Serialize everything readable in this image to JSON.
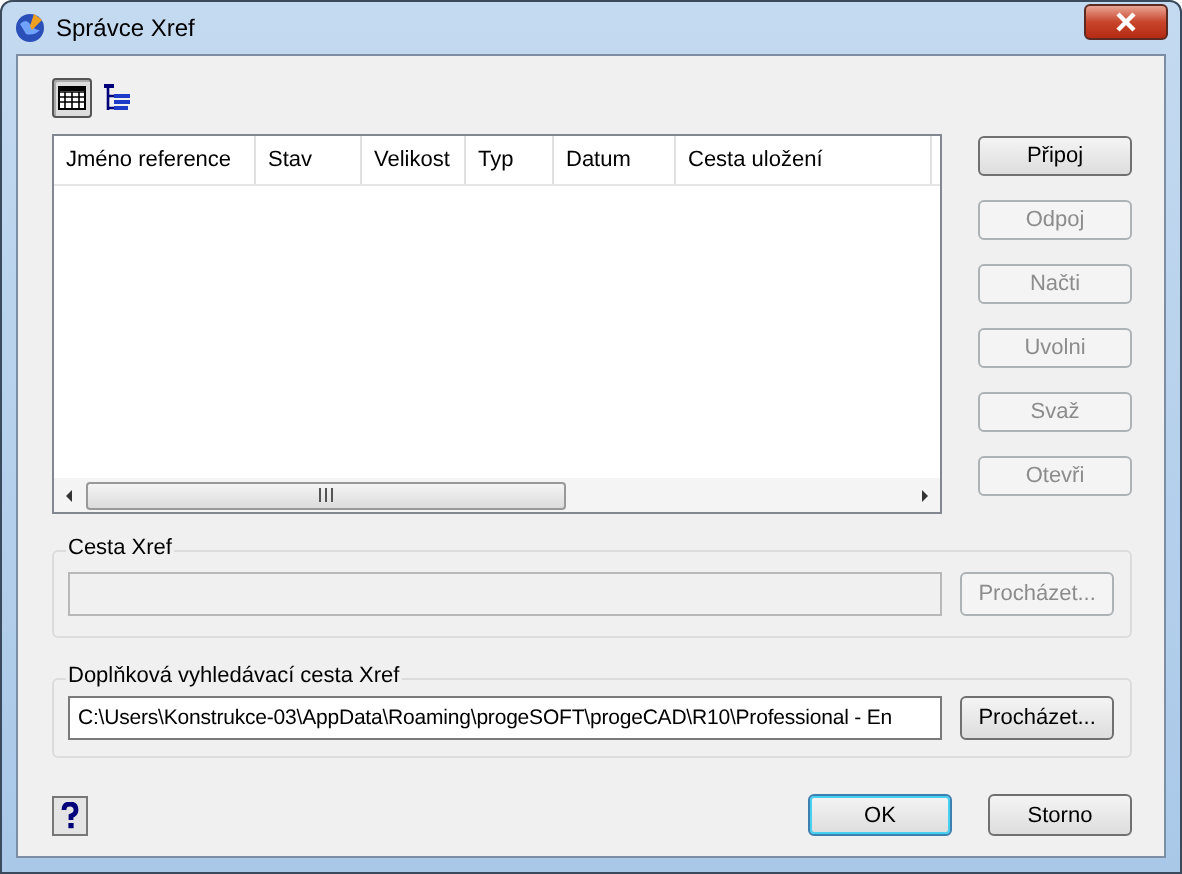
{
  "window": {
    "title": "Správce Xref"
  },
  "view_buttons": [
    {
      "kind": "list",
      "selected": true
    },
    {
      "kind": "tree",
      "selected": false
    }
  ],
  "table": {
    "columns": [
      "Jméno reference",
      "Stav",
      "Velikost",
      "Typ",
      "Datum",
      "Cesta uložení"
    ]
  },
  "side_buttons": [
    {
      "label": "Připoj",
      "disabled": false
    },
    {
      "label": "Odpoj",
      "disabled": true
    },
    {
      "label": "Načti",
      "disabled": true
    },
    {
      "label": "Uvolni",
      "disabled": true
    },
    {
      "label": "Svaž",
      "disabled": true
    },
    {
      "label": "Otevři",
      "disabled": true
    }
  ],
  "xref_path": {
    "title": "Cesta Xref",
    "disabled": true,
    "browse": {
      "label": "Procházet...",
      "disabled": true
    }
  },
  "search_path": {
    "title": "Doplňková vyhledávací cesta Xref",
    "value": "C:\\Users\\Konstrukce-03\\AppData\\Roaming\\progeSOFT\\progeCAD\\R10\\Professional - En",
    "disabled": false,
    "browse": {
      "label": "Procházet...",
      "disabled": false
    }
  },
  "buttons": [
    {
      "label": "OK",
      "default": true
    },
    {
      "label": "Storno",
      "default": false
    }
  ]
}
